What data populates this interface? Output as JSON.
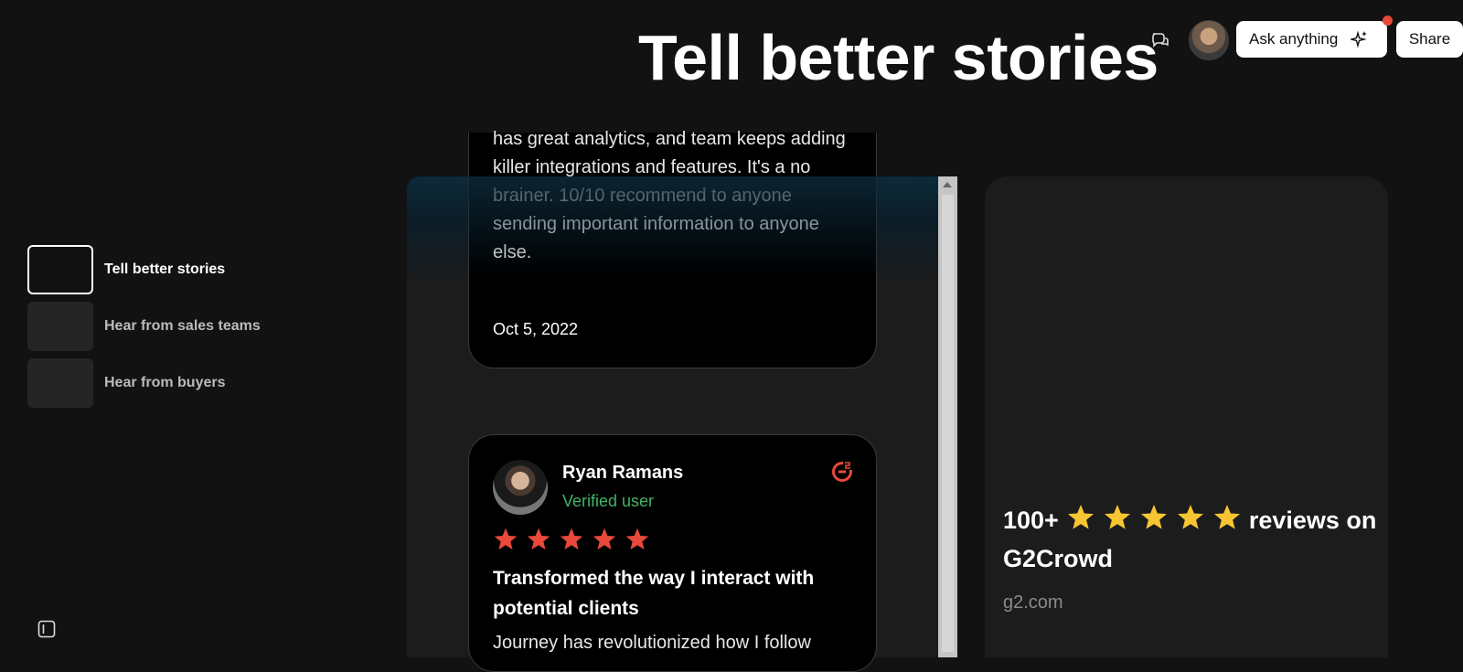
{
  "header": {
    "title": "Tell better stories",
    "ask_label": "Ask anything",
    "share_label": "Share"
  },
  "nav": {
    "items": [
      {
        "label": "Tell better stories",
        "active": true
      },
      {
        "label": "Hear from sales teams",
        "active": false
      },
      {
        "label": "Hear from buyers",
        "active": false
      }
    ]
  },
  "review_card_1": {
    "text": "has great analytics, and team keeps adding killer integrations and features. It's a no brainer. 10/10 recommend to anyone sending important information to anyone else.",
    "date": "Oct 5, 2022"
  },
  "review_card_2": {
    "name": "Ryan Ramans",
    "status": "Verified user",
    "rating": 5,
    "title": "Transformed the way I interact with potential clients",
    "body": "Journey has revolutionized how I follow"
  },
  "summary_card": {
    "count_text": "100+",
    "suffix_text": "reviews on G2Crowd",
    "rating": 5,
    "link": "g2.com"
  },
  "colors": {
    "accent_red": "#e8493a",
    "star_yellow": "#f7c531",
    "verified_green": "#3fb565"
  }
}
